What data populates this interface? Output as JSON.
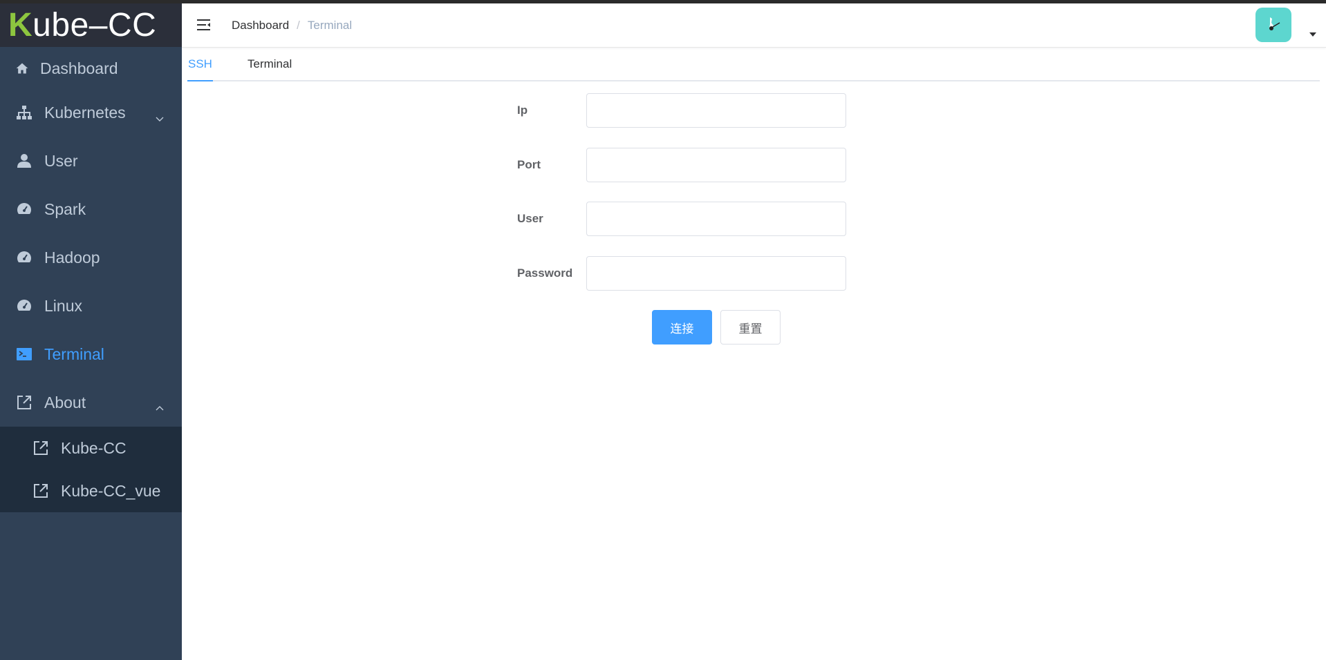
{
  "app": {
    "logo_prefix": "K",
    "logo_rest": "ube–CC"
  },
  "sidebar": {
    "items": [
      {
        "label": "Dashboard",
        "icon": "home-icon"
      },
      {
        "label": "Kubernetes",
        "icon": "sitemap-icon",
        "expanded": false
      },
      {
        "label": "User",
        "icon": "user-icon"
      },
      {
        "label": "Spark",
        "icon": "dashboard-gauge-icon"
      },
      {
        "label": "Hadoop",
        "icon": "dashboard-gauge-icon"
      },
      {
        "label": "Linux",
        "icon": "dashboard-gauge-icon"
      },
      {
        "label": "Terminal",
        "icon": "terminal-icon",
        "active": true
      },
      {
        "label": "About",
        "icon": "external-link-icon",
        "expanded": true
      }
    ],
    "about_children": [
      {
        "label": "Kube-CC",
        "icon": "external-link-icon"
      },
      {
        "label": "Kube-CC_vue",
        "icon": "external-link-icon"
      }
    ]
  },
  "header": {
    "breadcrumb": {
      "home": "Dashboard",
      "separator": "/",
      "current": "Terminal"
    }
  },
  "tabs": [
    {
      "label": "SSH",
      "active": true
    },
    {
      "label": "Terminal",
      "active": false
    }
  ],
  "form": {
    "ip": {
      "label": "Ip",
      "value": ""
    },
    "port": {
      "label": "Port",
      "value": ""
    },
    "user": {
      "label": "User",
      "value": ""
    },
    "password": {
      "label": "Password",
      "value": ""
    },
    "connect_label": "连接",
    "reset_label": "重置"
  },
  "colors": {
    "sidebar_bg": "#304156",
    "accent": "#409eff",
    "avatar_bg": "#5dd6cf"
  }
}
